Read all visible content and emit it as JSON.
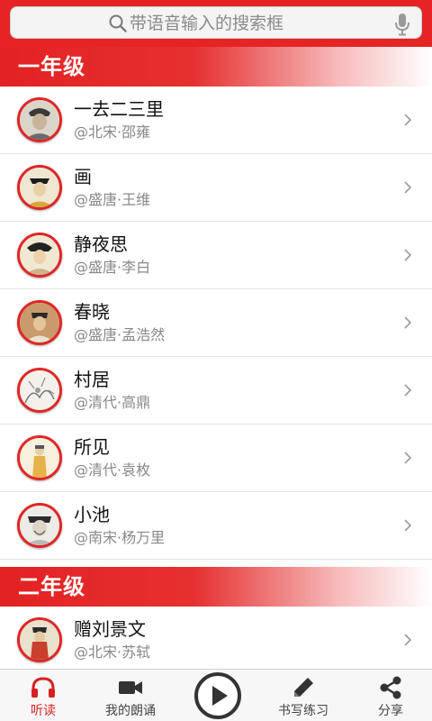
{
  "search": {
    "placeholder": "带语音输入的搜索框",
    "icon": "search-icon",
    "voice_icon": "microphone-icon"
  },
  "colors": {
    "accent": "#e52423",
    "avatar_ring": "#e02626",
    "active_tab": "#d92020"
  },
  "sections": [
    {
      "title": "一年级",
      "items": [
        {
          "title": "一去二三里",
          "subtitle": "@北宋·邵雍"
        },
        {
          "title": "画",
          "subtitle": "@盛唐·王维"
        },
        {
          "title": "静夜思",
          "subtitle": "@盛唐·李白"
        },
        {
          "title": "春晓",
          "subtitle": "@盛唐·孟浩然"
        },
        {
          "title": "村居",
          "subtitle": "@清代·高鼎"
        },
        {
          "title": "所见",
          "subtitle": "@清代·袁枚"
        },
        {
          "title": "小池",
          "subtitle": "@南宋·杨万里"
        }
      ]
    },
    {
      "title": "二年级",
      "items": [
        {
          "title": "赠刘景文",
          "subtitle": "@北宋·苏轼"
        }
      ]
    }
  ],
  "bottom_nav": {
    "listen": {
      "label": "听读",
      "icon": "headphones-icon",
      "active": true
    },
    "my_reading": {
      "label": "我的朗诵",
      "icon": "video-camera-icon"
    },
    "play": {
      "icon": "play-icon"
    },
    "writing": {
      "label": "书写练习",
      "icon": "pencil-icon"
    },
    "share": {
      "label": "分享",
      "icon": "share-icon"
    }
  }
}
